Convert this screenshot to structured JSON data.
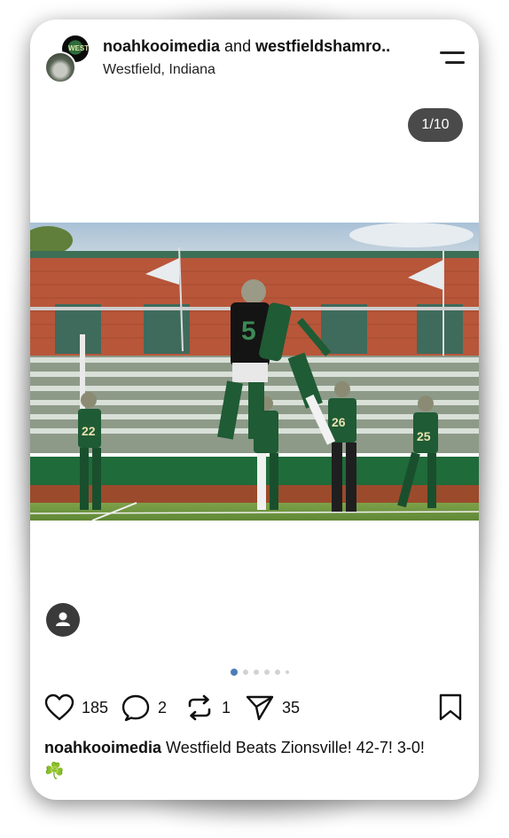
{
  "header": {
    "account1": "noahkooimedia",
    "joiner": "and",
    "account2": "westfieldshamro..",
    "location": "Westfield, Indiana",
    "avatar_text": "WEST"
  },
  "carousel": {
    "counter": "1/10",
    "slide_count": 6,
    "active_index": 0
  },
  "photo": {
    "jersey_number": "5"
  },
  "actions": {
    "likes": "185",
    "comments": "2",
    "reposts": "1",
    "shares": "35"
  },
  "caption": {
    "username": "noahkooimedia",
    "text": "Westfield Beats Zionsville! 42-7! 3-0!",
    "emoji": "☘️"
  },
  "colors": {
    "accent": "#4a7db8",
    "team_green": "#1f5b34"
  }
}
